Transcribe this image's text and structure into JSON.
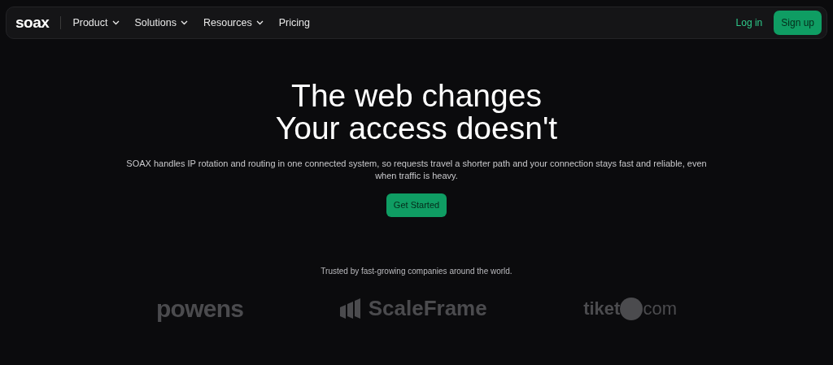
{
  "nav": {
    "logo": "soax",
    "items": [
      {
        "label": "Product",
        "dropdown": true
      },
      {
        "label": "Solutions",
        "dropdown": true
      },
      {
        "label": "Resources",
        "dropdown": true
      },
      {
        "label": "Pricing",
        "dropdown": false
      }
    ],
    "login": "Log in",
    "signup": "Sign up"
  },
  "hero": {
    "title_lines": [
      "The web changes",
      "Your access doesn't"
    ],
    "description": "SOAX handles IP rotation and routing in one connected system, so requests travel a shorter path and your connection stays fast and reliable, even when traffic is heavy.",
    "cta": "Get Started"
  },
  "trusted": {
    "text": "Trusted by fast-growing companies around the world.",
    "logos": [
      {
        "kind": "powens",
        "text": [
          "powens"
        ]
      },
      {
        "kind": "scaleframe",
        "text": [
          "ScaleFrame"
        ]
      },
      {
        "kind": "tiket",
        "text": [
          "tiket",
          "com"
        ]
      }
    ]
  }
}
